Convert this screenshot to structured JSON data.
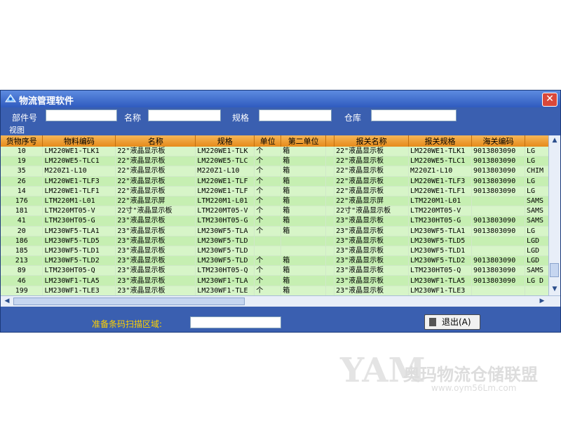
{
  "window": {
    "title": "物流管理软件",
    "close": "✕"
  },
  "filters": {
    "part_no_label": "部件号",
    "name_label": "名称",
    "spec_label": "规格",
    "warehouse_label": "仓库"
  },
  "view_label": "视图",
  "table": {
    "columns": [
      "货物序号",
      "物料编码",
      "名称",
      "规格",
      "单位",
      "第二单位",
      "",
      "报关名称",
      "报关规格",
      "海关编码",
      ""
    ],
    "rows": [
      [
        "10",
        "LM220WE1-TLK1",
        "22\"液晶显示板",
        "LM220WE1-TLK",
        "个",
        "箱",
        "",
        "22\"液晶显示板",
        "LM220WE1-TLK1",
        "9013803090",
        "LG"
      ],
      [
        "19",
        "LM220WE5-TLC1",
        "22\"液晶显示板",
        "LM220WE5-TLC",
        "个",
        "箱",
        "",
        "22\"液晶显示板",
        "LM220WE5-TLC1",
        "9013803090",
        "LG"
      ],
      [
        "35",
        "M220Z1-L10",
        "22\"液晶显示板",
        "M220Z1-L10",
        "个",
        "箱",
        "",
        "22\"液晶显示板",
        "M220Z1-L10",
        "9013803090",
        "CHIM"
      ],
      [
        "26",
        "LM220WE1-TLF3",
        "22\"液晶显示板",
        "LM220WE1-TLF",
        "个",
        "箱",
        "",
        "22\"液晶显示板",
        "LM220WE1-TLF3",
        "9013803090",
        "LG"
      ],
      [
        "14",
        "LM220WE1-TLF1",
        "22\"液晶显示板",
        "LM220WE1-TLF",
        "个",
        "箱",
        "",
        "22\"液晶显示板",
        "LM220WE1-TLF1",
        "9013803090",
        "LG"
      ],
      [
        "176",
        "LTM220M1-L01",
        "22\"液晶显示屏",
        "LTM220M1-L01",
        "个",
        "箱",
        "",
        "22\"液晶显示屏",
        "LTM220M1-L01",
        "",
        "SAMS"
      ],
      [
        "181",
        "LTM220MT05-V",
        "22寸\"液晶显示板",
        "LTM220MT05-V",
        "个",
        "箱",
        "",
        "22寸\"液晶显示板",
        "LTM220MT05-V",
        "",
        "SAMS"
      ],
      [
        "41",
        "LTM230HT05-G",
        "23\"液晶显示板",
        "LTM230HT05-G",
        "个",
        "箱",
        "",
        "23\"液晶显示板",
        "LTM230HT05-G",
        "9013803090",
        "SAMS"
      ],
      [
        "20",
        "LM230WF5-TLA1",
        "23\"液晶显示板",
        "LM230WF5-TLA",
        "个",
        "箱",
        "",
        "23\"液晶显示板",
        "LM230WF5-TLA1",
        "9013803090",
        "LG"
      ],
      [
        "186",
        "LM230WF5-TLD5",
        "23\"液晶显示板",
        "LM230WF5-TLD",
        "",
        "",
        "",
        "23\"液晶显示板",
        "LM230WF5-TLD5",
        "",
        "LGD"
      ],
      [
        "185",
        "LM230WF5-TLD1",
        "23\"液晶显示板",
        "LM230WF5-TLD",
        "",
        "",
        "",
        "23\"液晶显示板",
        "LM230WF5-TLD1",
        "",
        "LGD"
      ],
      [
        "213",
        "LM230WF5-TLD2",
        "23\"液晶显示板",
        "LM230WF5-TLD",
        "个",
        "箱",
        "",
        "23\"液晶显示板",
        "LM230WF5-TLD2",
        "9013803090",
        "LGD"
      ],
      [
        "89",
        "LTM230HT05-Q",
        "23\"液晶显示板",
        "LTM230HT05-Q",
        "个",
        "箱",
        "",
        "23\"液晶显示板",
        "LTM230HT05-Q",
        "9013803090",
        "SAMS"
      ],
      [
        "46",
        "LM230WF1-TLA5",
        "23\"液晶显示板",
        "LM230WF1-TLA",
        "个",
        "箱",
        "",
        "23\"液晶显示板",
        "LM230WF1-TLA5",
        "9013803090",
        "LG D"
      ],
      [
        "199",
        "LM230WF1-TLE3",
        "23\"液晶显示板",
        "LM230WF1-TLE",
        "个",
        "箱",
        "",
        "23\"液晶显示板",
        "LM230WF1-TLE3",
        "",
        ""
      ]
    ]
  },
  "bottom": {
    "scan_label": "准备条码扫描区域:",
    "exit_label": "退出(A)"
  },
  "watermark": {
    "logo": "YAM",
    "text": "奥玛物流仓储联盟",
    "url": "www.oym56Lm.com"
  }
}
